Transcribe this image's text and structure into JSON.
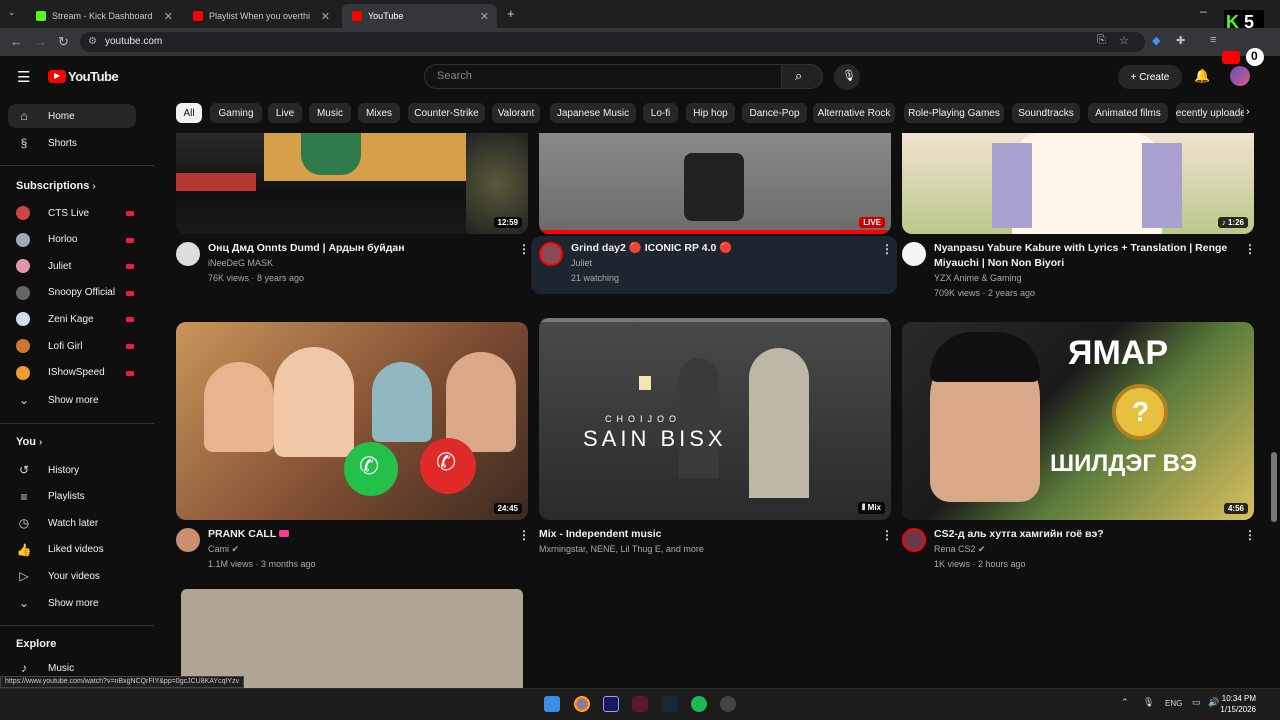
{
  "browser": {
    "tabs": [
      {
        "title": "Stream - Kick Dashboard",
        "favicon_color": "#53fc18"
      },
      {
        "title": "Playlist When you overthi",
        "favicon_color": "#ff0000"
      },
      {
        "title": "YouTube",
        "favicon_color": "#ff0000"
      }
    ],
    "url": "youtube.com",
    "status_url": "https://www.youtube.com/watch?v=nBxgNCQrFIY&pp=0gcJCU8KAYcqIYzv"
  },
  "header": {
    "logo_text": "YouTube",
    "search_placeholder": "Search",
    "create_label": "+ Create",
    "brand_color": "#ff0000"
  },
  "chips": [
    "All",
    "Gaming",
    "Live",
    "Music",
    "Mixes",
    "Counter-Strike",
    "Valorant",
    "Japanese Music",
    "Lo-fi",
    "Hip hop",
    "Dance-Pop",
    "Alternative Rock",
    "Role-Playing Games",
    "Soundtracks",
    "Animated films",
    "Recently uploaded"
  ],
  "sidebar": {
    "home": "Home",
    "shorts": "Shorts",
    "subscriptions_heading": "Subscriptions",
    "subscriptions": [
      "CTS Live",
      "Horloo",
      "Juliet",
      "Snoopy Official",
      "Zeni Kage",
      "Lofi Girl",
      "IShowSpeed"
    ],
    "show_more_1": "Show more",
    "you_heading": "You",
    "you_items": [
      "History",
      "Playlists",
      "Watch later",
      "Liked videos",
      "Your videos"
    ],
    "show_more_2": "Show more",
    "explore_heading": "Explore",
    "explore_items": [
      "Music"
    ]
  },
  "videos": [
    {
      "title": "Онц Дмд Onnts Dumd | Ардын буйдан",
      "channel": "iNeeDeG MASK",
      "meta": "76K views · 8 years ago",
      "duration": "12:59"
    },
    {
      "title": "Grind day2 🔴 ICONIC RP 4.0 🔴",
      "channel": "Juliet",
      "meta": "21 watching",
      "badge": "LIVE"
    },
    {
      "title": "Nyanpasu Yabure Kabure with Lyrics + Translation | Renge Miyauchi | Non Non Biyori",
      "channel": "YZX Anime & Gaming",
      "meta": "709K views · 2 years ago",
      "duration": "1:26"
    },
    {
      "title": "PRANK CALL",
      "channel": "Cami",
      "meta": "1.1M views · 3 months ago",
      "duration": "24:45"
    },
    {
      "title": "Mix - Independent music",
      "channel": "Mxrningstar, NENE, Lil Thug E, and more",
      "meta": "",
      "duration": "Mix",
      "overlay": "SAIN BISX",
      "overlay_top": "CHOIJOO"
    },
    {
      "title": "CS2-д аль хутга хамгийн гоё вэ?",
      "channel": "Rena CS2",
      "meta": "1K views · 2 hours ago",
      "duration": "4:56",
      "overlay": "ЯМАР",
      "overlay2": "ШИЛДЭГ ВЭ"
    }
  ],
  "taskbar": {
    "time": "10:34 PM",
    "date": "1/15/2026",
    "lang": "ENG"
  }
}
